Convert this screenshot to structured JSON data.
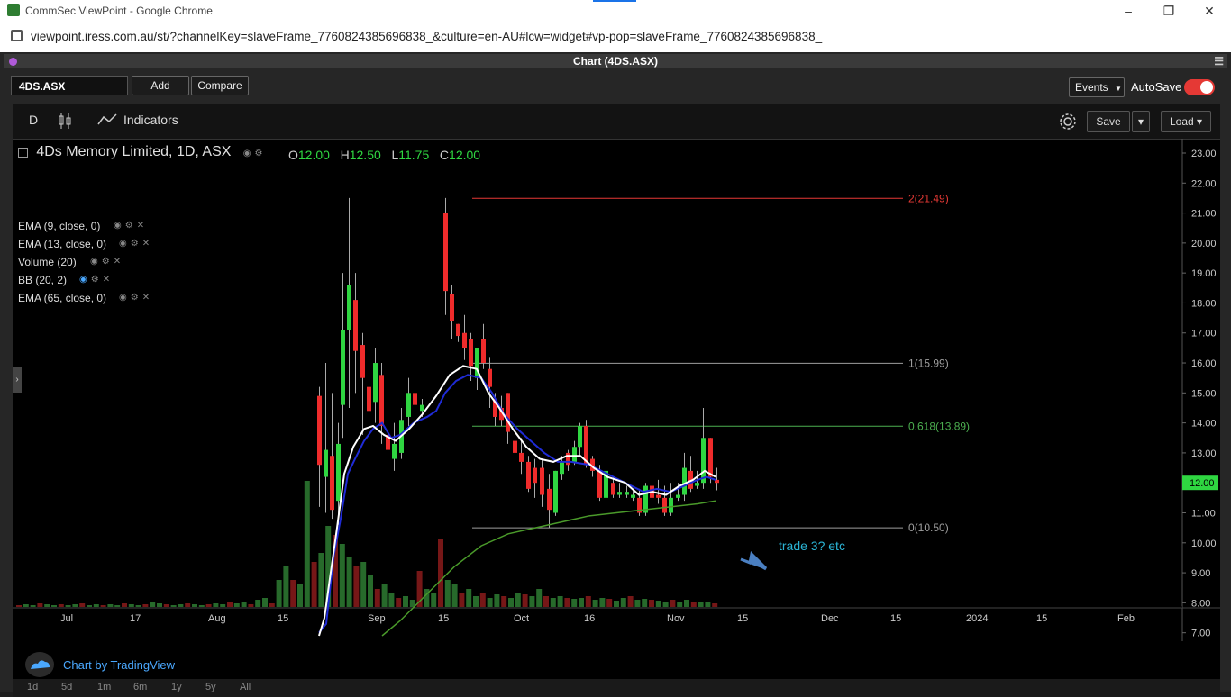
{
  "browser": {
    "window_title": "CommSec ViewPoint - Google Chrome",
    "url": "viewpoint.iress.com.au/st/?channelKey=slaveFrame_7760824385696838_&culture=en-AU#lcw=widget#vp-pop=slaveFrame_7760824385696838_"
  },
  "panel": {
    "title": "Chart (4DS.ASX)",
    "symbol": "4DS.ASX",
    "add_label": "Add",
    "compare_label": "Compare",
    "events_label": "Events",
    "autosave_label": "AutoSave",
    "autosave_on": true
  },
  "toolbar": {
    "interval": "D",
    "indicators_label": "Indicators",
    "save_label": "Save",
    "load_label": "Load"
  },
  "legend": {
    "main": "4Ds Memory Limited, 1D, ASX",
    "o_label": "O",
    "o": "12.00",
    "h_label": "H",
    "h": "12.50",
    "l_label": "L",
    "l": "11.75",
    "c_label": "C",
    "c": "12.00",
    "indicators": [
      "EMA (9, close, 0)",
      "EMA (13, close, 0)",
      "Volume (20)",
      "BB (20, 2)",
      "EMA (65, close, 0)"
    ]
  },
  "watermark": "Chart by TradingView",
  "ranges": [
    "1d",
    "5d",
    "1m",
    "6m",
    "1y",
    "5y",
    "All"
  ],
  "chart_data": {
    "type": "candlestick",
    "y_ticks": [
      "23.00",
      "22.00",
      "21.00",
      "20.00",
      "19.00",
      "18.00",
      "17.00",
      "16.00",
      "15.00",
      "14.00",
      "13.00",
      "12.00",
      "11.00",
      "10.00",
      "9.00",
      "8.00",
      "7.00"
    ],
    "ylim": [
      6.9,
      23.3
    ],
    "x_ticks": [
      "Jul",
      "17",
      "Aug",
      "15",
      "Sep",
      "15",
      "Oct",
      "16",
      "Nov",
      "15",
      "Dec",
      "15",
      "2024",
      "15",
      "Feb"
    ],
    "last_price": "12.00",
    "fib_levels": [
      {
        "label": "2(21.49)",
        "value": 21.49,
        "color": "#e53935"
      },
      {
        "label": "1(15.99)",
        "value": 15.99,
        "color": "#9e9e9e"
      },
      {
        "label": "0.618(13.89)",
        "value": 13.89,
        "color": "#4caf50"
      },
      {
        "label": "0(10.50)",
        "value": 10.5,
        "color": "#9e9e9e"
      }
    ],
    "annotation": "trade 3? etc",
    "colors": {
      "up": "#2fd641",
      "down": "#ef2b2b",
      "ema_fast": "#ffffff",
      "ema_mid": "#1f2bd6",
      "ema_slow": "#4a9a2a"
    }
  }
}
